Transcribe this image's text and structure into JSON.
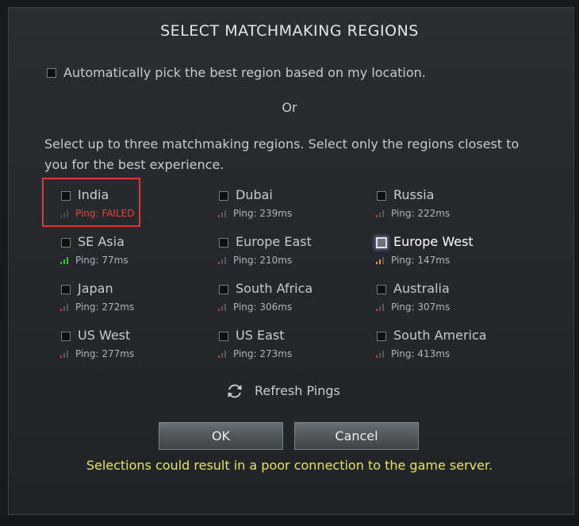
{
  "dialog": {
    "title": "SELECT MATCHMAKING REGIONS",
    "auto_pick": {
      "label": "Automatically pick the best region based on my location.",
      "checked": false
    },
    "or_text": "Or",
    "instructions": "Select up to three matchmaking regions. Select only the regions closest to you for the best experience."
  },
  "regions": [
    {
      "name": "India",
      "ping": "Ping: FAILED",
      "checked": false,
      "failed": true,
      "bar_colors": [
        "#4a4e51",
        "#4a4e51",
        "#4a4e51"
      ]
    },
    {
      "name": "Dubai",
      "ping": "Ping: 239ms",
      "checked": false,
      "failed": false,
      "bar_colors": [
        "#d9362e",
        "#55595c",
        "#55595c"
      ]
    },
    {
      "name": "Russia",
      "ping": "Ping: 222ms",
      "checked": false,
      "failed": false,
      "bar_colors": [
        "#d9362e",
        "#55595c",
        "#55595c"
      ]
    },
    {
      "name": "SE Asia",
      "ping": "Ping: 77ms",
      "checked": false,
      "failed": false,
      "bar_colors": [
        "#3fbf3f",
        "#3fbf3f",
        "#3fbf3f"
      ]
    },
    {
      "name": "Europe East",
      "ping": "Ping: 210ms",
      "checked": false,
      "failed": false,
      "bar_colors": [
        "#d9362e",
        "#55595c",
        "#55595c"
      ]
    },
    {
      "name": "Europe West",
      "ping": "Ping: 147ms",
      "checked": true,
      "failed": false,
      "bar_colors": [
        "#e89a2b",
        "#e89a2b",
        "#55595c"
      ]
    },
    {
      "name": "Japan",
      "ping": "Ping: 272ms",
      "checked": false,
      "failed": false,
      "bar_colors": [
        "#d9362e",
        "#55595c",
        "#55595c"
      ]
    },
    {
      "name": "South Africa",
      "ping": "Ping: 306ms",
      "checked": false,
      "failed": false,
      "bar_colors": [
        "#d9362e",
        "#55595c",
        "#55595c"
      ]
    },
    {
      "name": "Australia",
      "ping": "Ping: 307ms",
      "checked": false,
      "failed": false,
      "bar_colors": [
        "#d9362e",
        "#55595c",
        "#55595c"
      ]
    },
    {
      "name": "US West",
      "ping": "Ping: 277ms",
      "checked": false,
      "failed": false,
      "bar_colors": [
        "#d9362e",
        "#55595c",
        "#55595c"
      ]
    },
    {
      "name": "US East",
      "ping": "Ping: 273ms",
      "checked": false,
      "failed": false,
      "bar_colors": [
        "#d9362e",
        "#55595c",
        "#55595c"
      ]
    },
    {
      "name": "South America",
      "ping": "Ping: 413ms",
      "checked": false,
      "failed": false,
      "bar_colors": [
        "#d9362e",
        "#55595c",
        "#55595c"
      ]
    }
  ],
  "refresh": {
    "label": "Refresh Pings",
    "icon": "refresh-icon"
  },
  "buttons": {
    "ok_label": "OK",
    "cancel_label": "Cancel"
  },
  "warning": "Selections could result in a poor connection to the game server.",
  "colors": {
    "warning_text": "#e8e45e",
    "failed_text": "#e0463d",
    "highlight_border": "#e0353a",
    "ping_good": "#3fbf3f",
    "ping_medium": "#e89a2b",
    "ping_bad": "#d9362e"
  }
}
